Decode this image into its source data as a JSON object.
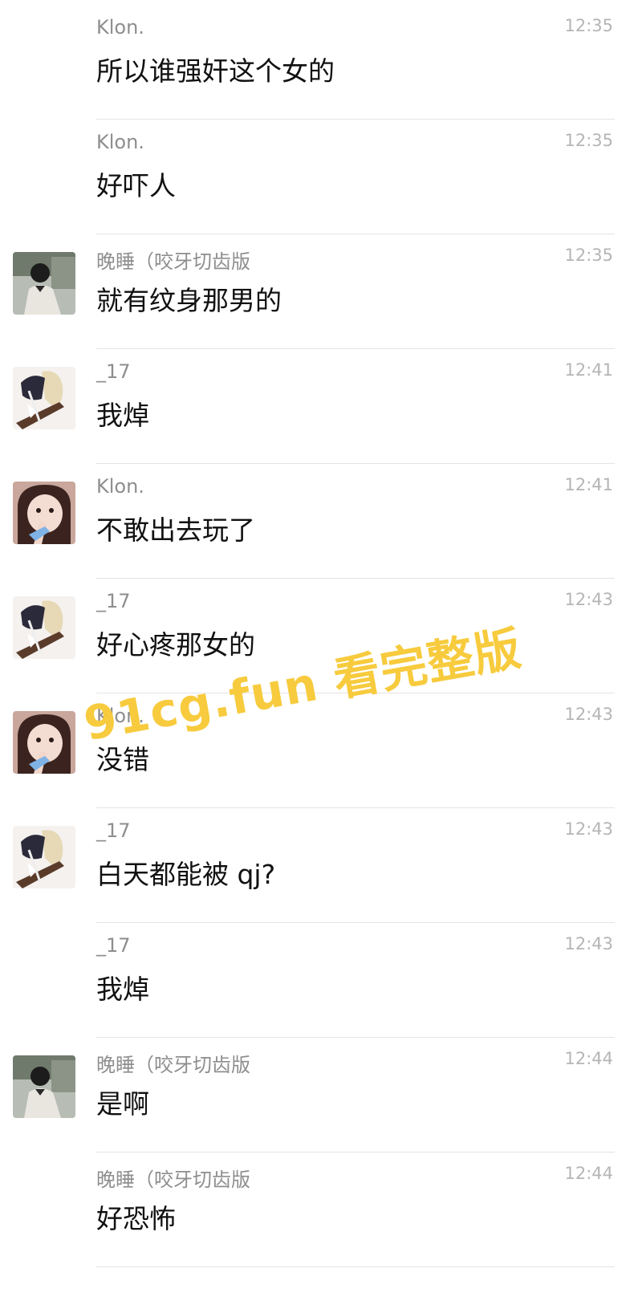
{
  "messages": [
    {
      "sender": "Klon.",
      "time": "12:35",
      "text": "所以谁强奸这个女的",
      "avatar": "none"
    },
    {
      "sender": "Klon.",
      "time": "12:35",
      "text": "好吓人",
      "avatar": "none"
    },
    {
      "sender": "晚睡（咬牙切齿版",
      "time": "12:35",
      "text": "就有纹身那男的",
      "avatar": "avatar-wanshui"
    },
    {
      "sender": "_17",
      "time": "12:41",
      "text": "我焯",
      "avatar": "avatar-17"
    },
    {
      "sender": "Klon.",
      "time": "12:41",
      "text": "不敢出去玩了",
      "avatar": "avatar-klon"
    },
    {
      "sender": "_17",
      "time": "12:43",
      "text": "好心疼那女的",
      "avatar": "avatar-17"
    },
    {
      "sender": "Klon.",
      "time": "12:43",
      "text": "没错",
      "avatar": "avatar-klon"
    },
    {
      "sender": "_17",
      "time": "12:43",
      "text": "白天都能被 qj?",
      "avatar": "avatar-17"
    },
    {
      "sender": "_17",
      "time": "12:43",
      "text": "我焯",
      "avatar": "none"
    },
    {
      "sender": "晚睡（咬牙切齿版",
      "time": "12:44",
      "text": "是啊",
      "avatar": "avatar-wanshui"
    },
    {
      "sender": "晚睡（咬牙切齿版",
      "time": "12:44",
      "text": "好恐怖",
      "avatar": "none"
    }
  ],
  "watermark": {
    "text": "91cg.fun 看完整版",
    "color": "#f7cb3d"
  }
}
